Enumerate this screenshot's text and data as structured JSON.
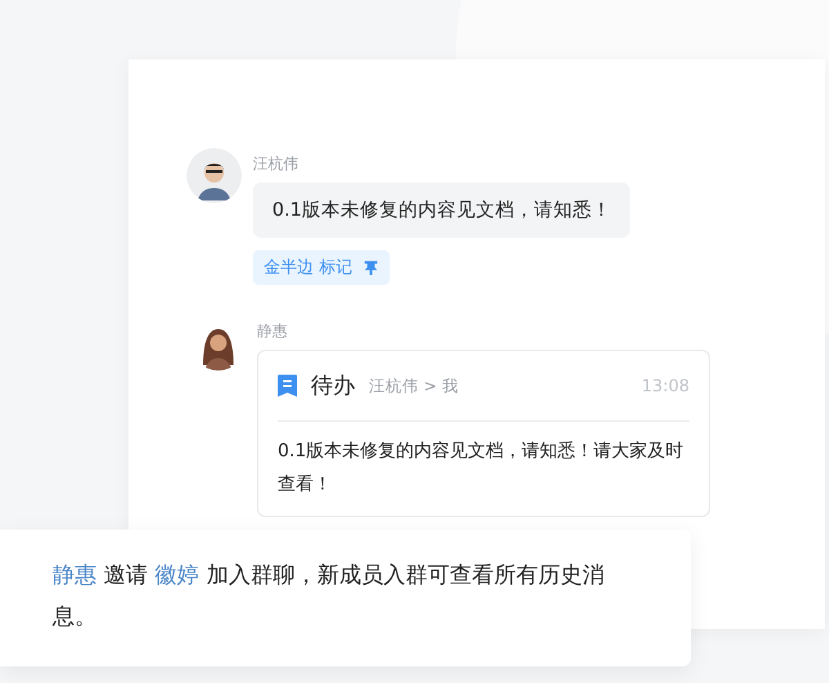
{
  "messages": [
    {
      "kind": "text",
      "sender": "汪杭伟",
      "text": "0.1版本未修复的内容见文档，请知悉！",
      "mark": {
        "label": "金半边 标记"
      }
    },
    {
      "kind": "todo",
      "sender": "静惠",
      "card": {
        "title": "待办",
        "route": "汪杭伟 > 我",
        "time": "13:08",
        "text": "0.1版本未修复的内容见文档，请知悉！请大家及时查看！"
      }
    }
  ],
  "notice": {
    "parts": [
      {
        "kind": "user",
        "text": "静惠"
      },
      {
        "kind": "plain",
        "text": " 邀请 "
      },
      {
        "kind": "user",
        "text": "徽婷"
      },
      {
        "kind": "plain",
        "text": " 加入群聊，新成员入群可查看所有历史消息。"
      }
    ]
  }
}
